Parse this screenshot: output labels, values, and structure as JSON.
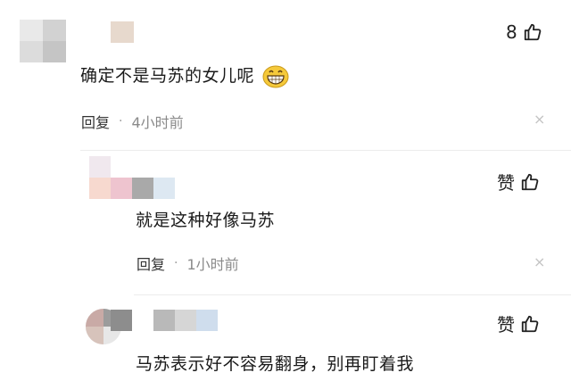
{
  "comments": [
    {
      "text": "确定不是马苏的女儿呢",
      "emoji": "grinning-face-emoji",
      "reply_label": "回复",
      "separator": "·",
      "time": "4小时前",
      "like_label": "8",
      "close_glyph": "×"
    },
    {
      "text": "就是这种好像马苏",
      "reply_label": "回复",
      "separator": "·",
      "time": "1小时前",
      "like_label": "赞",
      "close_glyph": "×"
    },
    {
      "text": "马苏表示好不容易翻身，别再盯着我",
      "like_label": "赞"
    }
  ],
  "icons": {
    "like": "thumbs-up-icon",
    "close": "close-icon"
  },
  "colors": {
    "text": "#1a1a1a",
    "meta": "#8a8a8a",
    "divider": "#ececec",
    "close": "#c4c4c4"
  }
}
